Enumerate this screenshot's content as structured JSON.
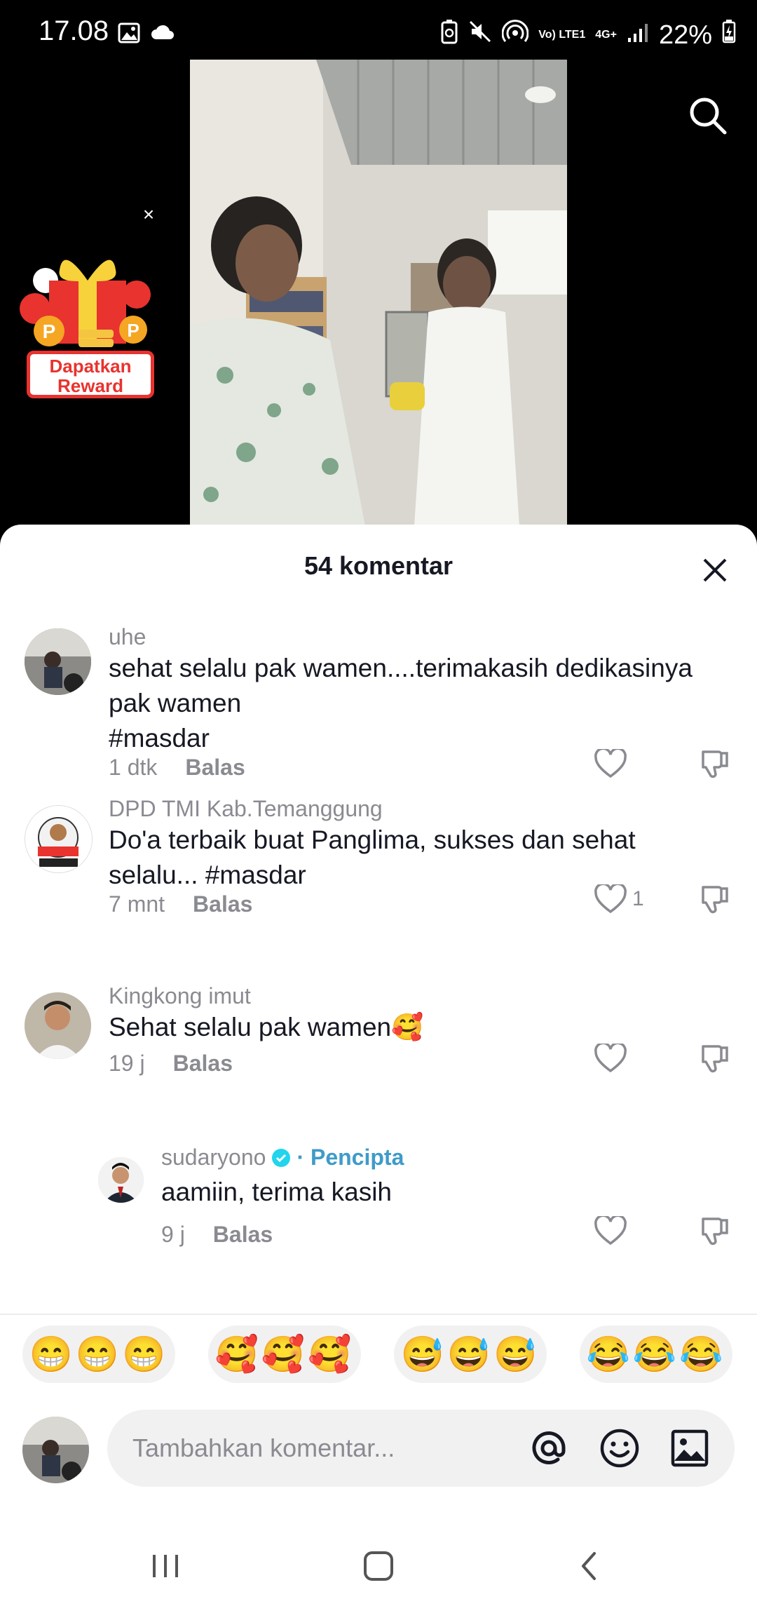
{
  "status_bar": {
    "time": "17.08",
    "network_top": "Vo) LTE1",
    "network_bottom": "4G+",
    "battery": "22%"
  },
  "reward": {
    "label_line1": "Dapatkan",
    "label_line2": "Reward",
    "close": "×"
  },
  "sheet": {
    "title": "54 komentar"
  },
  "comments": [
    {
      "user": "uhe",
      "lines": [
        "sehat selalu pak wamen....terimakasih dedikasinya",
        "pak wamen",
        "#masdar"
      ],
      "time": "1 dtk",
      "reply": "Balas",
      "likes": ""
    },
    {
      "user": "DPD TMI Kab.Temanggung",
      "lines": [
        "Do'a terbaik buat Panglima, sukses dan sehat",
        "selalu... #masdar"
      ],
      "time": "7 mnt",
      "reply": "Balas",
      "likes": "1"
    },
    {
      "user": "Kingkong imut",
      "lines": [
        "Sehat selalu pak wamen🥰"
      ],
      "time": "19 j",
      "reply": "Balas",
      "likes": ""
    }
  ],
  "reply": {
    "user": "sudaryono",
    "creator_tag": "· Pencipta",
    "text": "aamiin, terima kasih",
    "time": "9 j",
    "reply": "Balas"
  },
  "emoji_bar": [
    "😁😁😁",
    "🥰🥰🥰",
    "😅😅😅",
    "😂😂😂"
  ],
  "input": {
    "placeholder": "Tambahkan komentar..."
  },
  "colors": {
    "creator_tag": "#3f9bc9",
    "verified": "#20d5ec",
    "reward_red": "#e8332f"
  }
}
